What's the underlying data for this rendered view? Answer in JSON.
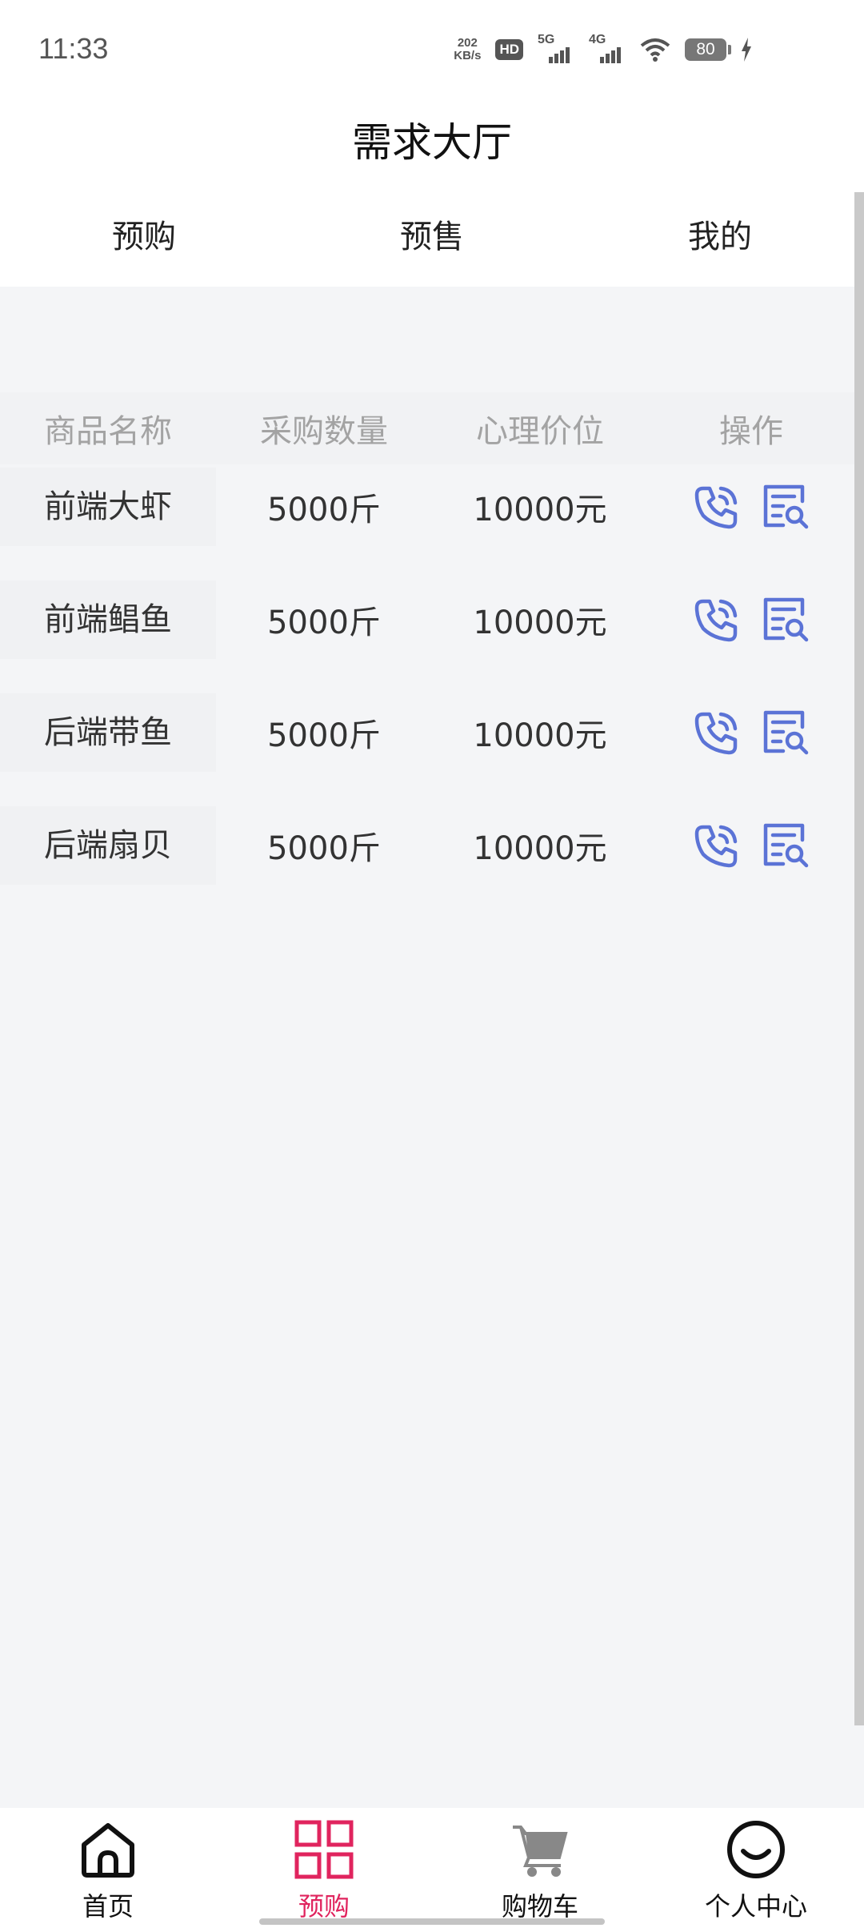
{
  "status_bar": {
    "time": "11:33",
    "net_speed_value": "202",
    "net_speed_unit": "KB/s",
    "hd_label": "HD",
    "sim1_label": "5G",
    "sim2_label": "4G",
    "battery": "80"
  },
  "header": {
    "title": "需求大厅"
  },
  "tabs": [
    {
      "label": "预购"
    },
    {
      "label": "预售"
    },
    {
      "label": "我的"
    }
  ],
  "table": {
    "columns": [
      "商品名称",
      "采购数量",
      "心理价位",
      "操作"
    ],
    "rows": [
      {
        "name": "前端大虾",
        "quantity": "5000斤",
        "price": "10000元"
      },
      {
        "name": "前端鲳鱼",
        "quantity": "5000斤",
        "price": "10000元"
      },
      {
        "name": "后端带鱼",
        "quantity": "5000斤",
        "price": "10000元"
      },
      {
        "name": "后端扇贝",
        "quantity": "5000斤",
        "price": "10000元"
      }
    ]
  },
  "bottom_nav": [
    {
      "label": "首页",
      "icon": "home-icon"
    },
    {
      "label": "预购",
      "icon": "grid-icon",
      "active": true
    },
    {
      "label": "购物车",
      "icon": "cart-icon"
    },
    {
      "label": "个人中心",
      "icon": "smiley-icon"
    }
  ],
  "colors": {
    "accent": "#e0245e",
    "action_icon": "#5b73d6",
    "page_bg": "#f4f5f7"
  }
}
